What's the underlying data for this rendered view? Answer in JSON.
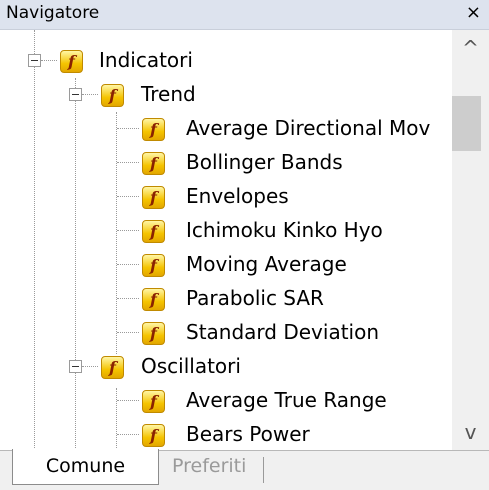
{
  "window": {
    "title": "Navigatore",
    "close_glyph": "×"
  },
  "tree": {
    "icon_glyph": "f",
    "nodes": [
      {
        "label": "Indicatori",
        "level": 1,
        "expanded": true
      },
      {
        "label": "Trend",
        "level": 2,
        "expanded": true
      },
      {
        "label": "Average Directional Mov",
        "level": 3
      },
      {
        "label": "Bollinger Bands",
        "level": 3
      },
      {
        "label": "Envelopes",
        "level": 3
      },
      {
        "label": "Ichimoku Kinko Hyo",
        "level": 3
      },
      {
        "label": "Moving Average",
        "level": 3
      },
      {
        "label": "Parabolic SAR",
        "level": 3
      },
      {
        "label": "Standard Deviation",
        "level": 3
      },
      {
        "label": "Oscillatori",
        "level": 2,
        "expanded": true
      },
      {
        "label": "Average True Range",
        "level": 3
      },
      {
        "label": "Bears Power",
        "level": 3
      }
    ]
  },
  "scrollbar": {
    "up_glyph": "^",
    "down_glyph": "v"
  },
  "tabs": {
    "active": "Comune",
    "other": "Preferiti"
  }
}
